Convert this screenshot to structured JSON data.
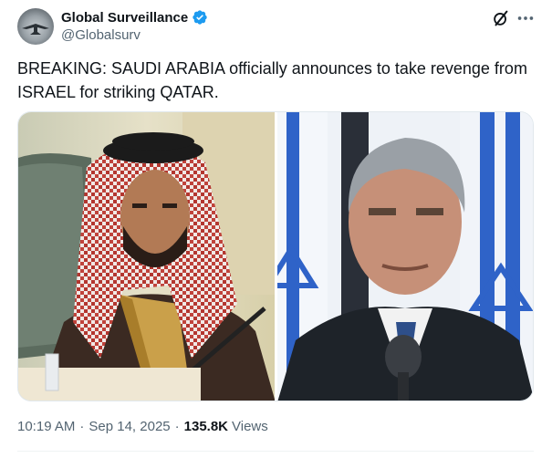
{
  "author": {
    "display_name": "Global Surveillance",
    "handle": "@Globalsurv",
    "verified": true,
    "verified_color": "#1d9bf0"
  },
  "header_actions": {
    "grok_icon": "grok-slash-icon",
    "more_icon": "more-dots-icon"
  },
  "tweet": {
    "text": "BREAKING: SAUDI ARABIA officially announces to take revenge from ISRAEL for striking QATAR."
  },
  "media": {
    "images": [
      {
        "subject": "man-in-red-keffiyeh"
      },
      {
        "subject": "man-in-suit-with-flags"
      }
    ]
  },
  "meta": {
    "time": "10:19 AM",
    "date": "Sep 14, 2025",
    "views_count": "135.8K",
    "views_label": "Views"
  },
  "colors": {
    "text_primary": "#0f1419",
    "text_secondary": "#536471",
    "accent": "#1d9bf0"
  }
}
